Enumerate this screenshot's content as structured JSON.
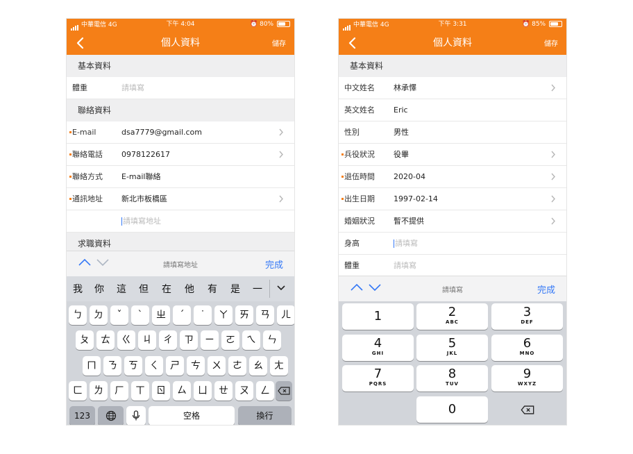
{
  "left": {
    "status": {
      "carrier": "中華電信 4G",
      "time": "下午 4:04",
      "battery": "80%",
      "battery_level": 0.8
    },
    "nav": {
      "title": "個人資料",
      "save": "儲存"
    },
    "sections": {
      "basic": "基本資料",
      "contact": "聯絡資料",
      "job": "求職資料"
    },
    "weight": {
      "label": "體重",
      "placeholder": "請填寫"
    },
    "email": {
      "label": "E-mail",
      "value": "dsa7779@gmail.com"
    },
    "phone": {
      "label": "聯絡電話",
      "value": "0978122617"
    },
    "contact_method": {
      "label": "聯絡方式",
      "value": "E-mail聯絡"
    },
    "address": {
      "label": "通訊地址",
      "value": "新北市板橋區",
      "detail_placeholder": "請填寫地址"
    },
    "accessory": {
      "hint": "請填寫地址",
      "done": "完成"
    },
    "candidates": [
      "我",
      "你",
      "這",
      "但",
      "在",
      "他",
      "有",
      "是",
      "一"
    ],
    "keyboard": {
      "row1": [
        "ㄅ",
        "ㄉ",
        "ˇ",
        "ˋ",
        "ㄓ",
        "ˊ",
        "˙",
        "ㄚ",
        "ㄞ",
        "ㄢ",
        "ㄦ"
      ],
      "row2": [
        "ㄆ",
        "ㄊ",
        "ㄍ",
        "ㄐ",
        "ㄔ",
        "ㄗ",
        "ㄧ",
        "ㄛ",
        "ㄟ",
        "ㄣ"
      ],
      "row3": [
        "ㄇ",
        "ㄋ",
        "ㄎ",
        "ㄑ",
        "ㄕ",
        "ㄘ",
        "ㄨ",
        "ㄜ",
        "ㄠ",
        "ㄤ"
      ],
      "row4": [
        "ㄈ",
        "ㄌ",
        "ㄏ",
        "ㄒ",
        "ㄖ",
        "ㄙ",
        "ㄩ",
        "ㄝ",
        "ㄡ",
        "ㄥ"
      ],
      "num_key": "123",
      "space": "空格",
      "return": "換行"
    }
  },
  "right": {
    "status": {
      "carrier": "中華電信 4G",
      "time": "下午 3:31",
      "battery": "85%",
      "battery_level": 0.85
    },
    "nav": {
      "title": "個人資料",
      "save": "儲存"
    },
    "sections": {
      "basic": "基本資料"
    },
    "rows": [
      {
        "label": "中文姓名",
        "value": "林承懌",
        "required": false,
        "chevron": true,
        "placeholder": false
      },
      {
        "label": "英文姓名",
        "value": "Eric",
        "required": false,
        "chevron": false,
        "placeholder": false
      },
      {
        "label": "性別",
        "value": "男性",
        "required": false,
        "chevron": false,
        "placeholder": false
      },
      {
        "label": "兵役狀況",
        "value": "役畢",
        "required": true,
        "chevron": true,
        "placeholder": false
      },
      {
        "label": "退伍時間",
        "value": "2020-04",
        "required": true,
        "chevron": true,
        "placeholder": false
      },
      {
        "label": "出生日期",
        "value": "1997-02-14",
        "required": true,
        "chevron": true,
        "placeholder": false
      },
      {
        "label": "婚姻狀況",
        "value": "暫不提供",
        "required": false,
        "chevron": true,
        "placeholder": false
      },
      {
        "label": "身高",
        "value": "請填寫",
        "required": false,
        "chevron": false,
        "placeholder": true,
        "focused": true
      },
      {
        "label": "體重",
        "value": "請填寫",
        "required": false,
        "chevron": false,
        "placeholder": true
      }
    ],
    "accessory": {
      "hint": "請填寫",
      "done": "完成"
    },
    "numpad": [
      {
        "digit": "1",
        "letters": ""
      },
      {
        "digit": "2",
        "letters": "ABC"
      },
      {
        "digit": "3",
        "letters": "DEF"
      },
      {
        "digit": "4",
        "letters": "GHI"
      },
      {
        "digit": "5",
        "letters": "JKL"
      },
      {
        "digit": "6",
        "letters": "MNO"
      },
      {
        "digit": "7",
        "letters": "PQRS"
      },
      {
        "digit": "8",
        "letters": "TUV"
      },
      {
        "digit": "9",
        "letters": "WXYZ"
      },
      {
        "digit": "0",
        "letters": ""
      }
    ]
  },
  "colors": {
    "brand_orange": "#f57f17",
    "link_blue": "#3478f6",
    "section_bg": "#efeff0",
    "keyboard_bg": "#d2d5da"
  },
  "icons": [
    "back-chevron-icon",
    "chevron-right-icon",
    "signal-icon",
    "alarm-icon",
    "battery-icon",
    "globe-icon",
    "microphone-icon",
    "delete-icon",
    "dismiss-keyboard-icon",
    "up-arrow-icon",
    "down-arrow-icon"
  ]
}
